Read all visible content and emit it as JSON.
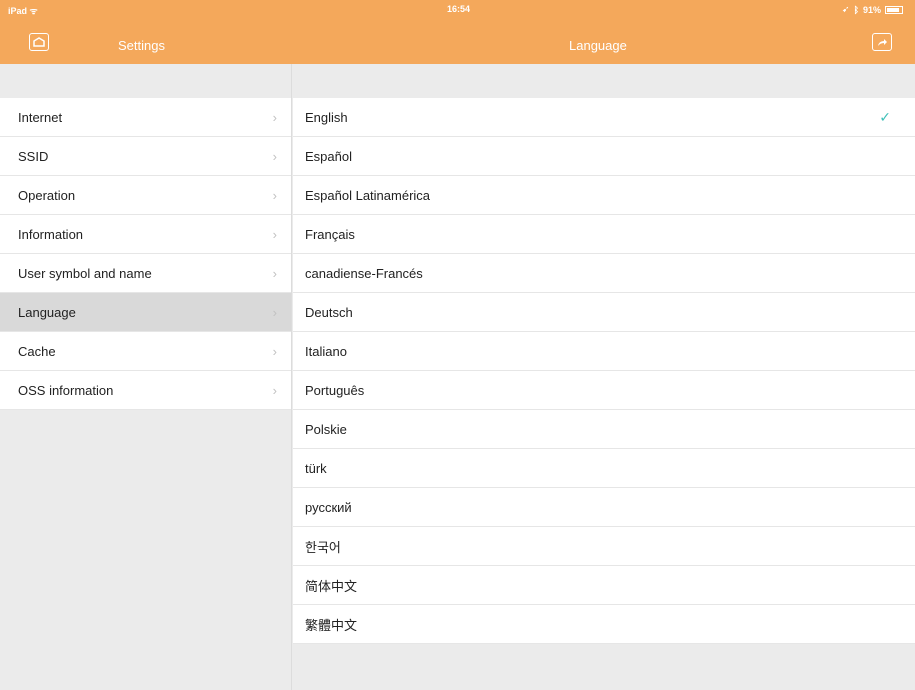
{
  "status_bar": {
    "device": "iPad",
    "time": "16:54",
    "battery": "91%"
  },
  "nav": {
    "left_title": "Settings",
    "left_icon": "home-icon",
    "right_title": "Language",
    "right_icon": "share-icon"
  },
  "colors": {
    "bar": "#f4a85b",
    "check": "#3fc0b8"
  },
  "settings_menu": [
    {
      "label": "Internet"
    },
    {
      "label": "SSID"
    },
    {
      "label": "Operation"
    },
    {
      "label": "Information"
    },
    {
      "label": "User symbol and name"
    },
    {
      "label": "Language",
      "selected": true
    },
    {
      "label": "Cache"
    },
    {
      "label": "OSS information"
    }
  ],
  "languages": [
    {
      "label": "English",
      "checked": true
    },
    {
      "label": "Español"
    },
    {
      "label": "Español Latinamérica"
    },
    {
      "label": "Français"
    },
    {
      "label": "canadiense-Francés"
    },
    {
      "label": "Deutsch"
    },
    {
      "label": "Italiano"
    },
    {
      "label": "Português"
    },
    {
      "label": "Polskie"
    },
    {
      "label": "türk"
    },
    {
      "label": "русский"
    },
    {
      "label": "한국어"
    },
    {
      "label": "简体中文"
    },
    {
      "label": "繁體中文"
    }
  ]
}
